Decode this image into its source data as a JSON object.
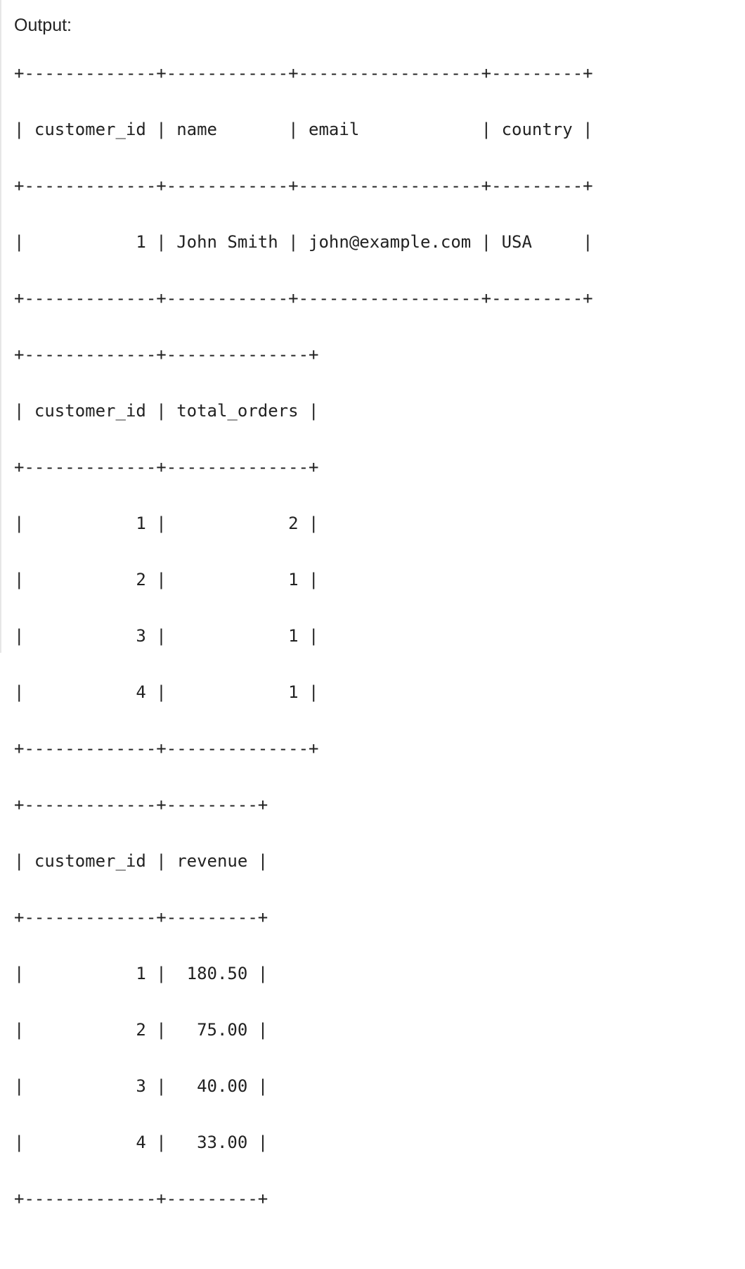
{
  "output_label": "Output:",
  "console_lines": [
    "+-------------+------------+------------------+---------+",
    "| customer_id | name       | email            | country |",
    "+-------------+------------+------------------+---------+",
    "|           1 | John Smith | john@example.com | USA     |",
    "+-------------+------------+------------------+---------+",
    "+-------------+--------------+",
    "| customer_id | total_orders |",
    "+-------------+--------------+",
    "|           1 |            2 |",
    "|           2 |            1 |",
    "|           3 |            1 |",
    "|           4 |            1 |",
    "+-------------+--------------+",
    "+-------------+---------+",
    "| customer_id | revenue |",
    "+-------------+---------+",
    "|           1 |  180.50 |",
    "|           2 |   75.00 |",
    "|           3 |   40.00 |",
    "|           4 |   33.00 |",
    "+-------------+---------+"
  ]
}
